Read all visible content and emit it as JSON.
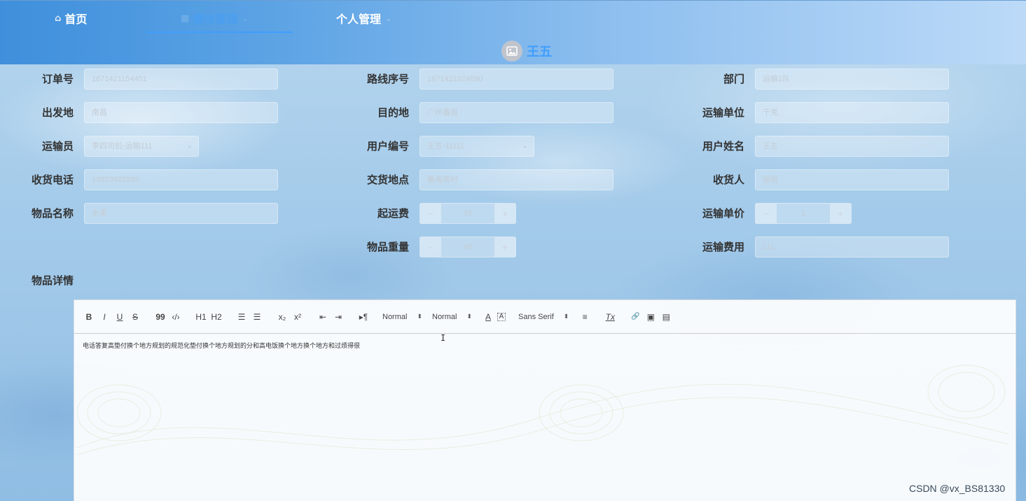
{
  "nav": {
    "home": "首页",
    "module": "模块管理",
    "personal": "个人管理",
    "user_name": "王五"
  },
  "form": {
    "order_no": {
      "label": "订单号",
      "value": "1671421154451"
    },
    "route_no": {
      "label": "路线序号",
      "value": "1671421024890"
    },
    "dept": {
      "label": "部门",
      "value": "运输1队"
    },
    "origin": {
      "label": "出发地",
      "value": "南昌"
    },
    "destination": {
      "label": "目的地",
      "value": "广州番禺"
    },
    "carrier_unit": {
      "label": "运输单位",
      "value": "千克"
    },
    "transporter": {
      "label": "运输员",
      "value": "李四司机-运输111"
    },
    "user_no": {
      "label": "用户编号",
      "value": "王五-11111"
    },
    "user_name": {
      "label": "用户姓名",
      "value": "王五"
    },
    "recv_phone": {
      "label": "收货电话",
      "value": "13623923239"
    },
    "delivery_place": {
      "label": "交货地点",
      "value": "番禺南村"
    },
    "receiver": {
      "label": "收货人",
      "value": "丽丽"
    },
    "item_name": {
      "label": "物品名称",
      "value": "水果"
    },
    "start_fee": {
      "label": "起运费",
      "value": "15",
      "minus": "−",
      "plus": "+"
    },
    "unit_price": {
      "label": "运输单价",
      "value": "2",
      "minus": "−",
      "plus": "+"
    },
    "weight": {
      "label": "物品重量",
      "value": "48",
      "minus": "−",
      "plus": "+"
    },
    "fee": {
      "label": "运输费用",
      "value": "111"
    },
    "detail": {
      "label": "物品详情"
    }
  },
  "editor": {
    "toolbar": {
      "bold": "B",
      "italic": "I",
      "underline": "U",
      "strike": "S",
      "quote": "99",
      "code": "‹/›",
      "h1": "H1",
      "h2": "H2",
      "ordered": "☰",
      "bullet": "☰",
      "sub": "x₂",
      "sup": "x²",
      "outdent": "⇤",
      "indent": "⇥",
      "direction": "▸¶",
      "size": "Normal",
      "header": "Normal",
      "color": "A",
      "background": "A",
      "font": "Sans Serif",
      "align": "≡",
      "clean": "Tx",
      "link": "🔗",
      "image": "▣",
      "video": "▤"
    },
    "content": "电话答复高垫付换个地方规划的规范化垫付换个地方规划的分和高电饭换个地方换个地方和过烦得很"
  },
  "cursor": "I",
  "watermark": "CSDN @vx_BS81330"
}
